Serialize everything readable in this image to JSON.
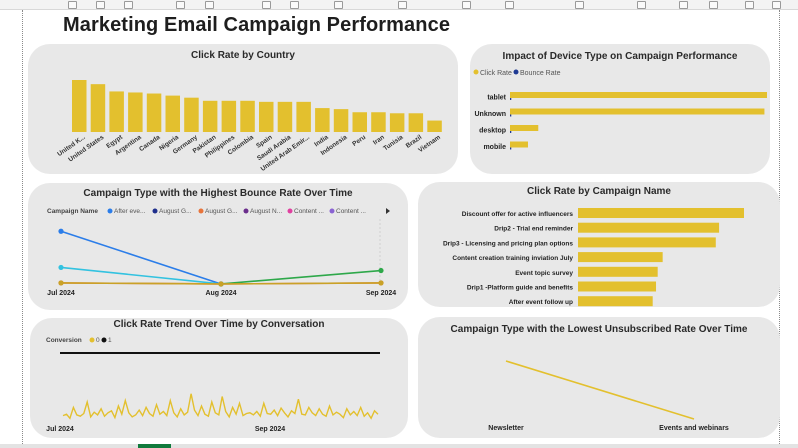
{
  "page": {
    "title": "Marketing Email Campaign Performance",
    "colors": {
      "gold": "#e3c02e",
      "card_bg": "#e8e8e8",
      "title": "#1e1e1e"
    }
  },
  "chart_data": [
    {
      "id": "click_rate_by_country",
      "type": "bar",
      "title": "Click Rate by Country",
      "categories": [
        "United K...",
        "United States",
        "Egypt",
        "Argentina",
        "Canada",
        "Nigeria",
        "Germany",
        "Pakistan",
        "Philippines",
        "Colombia",
        "Spain",
        "Saudi Arabia",
        "United Arab Emir...",
        "India",
        "Indonesia",
        "Peru",
        "Iran",
        "Tunisia",
        "Brazil",
        "Vietnam"
      ],
      "values": [
        50,
        46,
        39,
        38,
        37,
        35,
        33,
        30,
        30,
        30,
        29,
        29,
        29,
        23,
        22,
        19,
        19,
        18,
        18,
        11
      ],
      "color": "#e3c02e"
    },
    {
      "id": "device_type_impact",
      "type": "bar",
      "orientation": "horizontal",
      "title": "Impact of Device Type on Campaign Performance",
      "legend": [
        {
          "label": "Click Rate",
          "color": "#e3c02e"
        },
        {
          "label": "Bounce Rate",
          "color": "#1f3a93"
        }
      ],
      "categories": [
        "tablet",
        "Unknown",
        "desktop",
        "mobile"
      ],
      "series": [
        {
          "name": "Click Rate",
          "values": [
            100,
            99,
            11,
            7
          ]
        },
        {
          "name": "Bounce Rate",
          "values": [
            0.5,
            0.5,
            0.5,
            0.5
          ]
        }
      ]
    },
    {
      "id": "campaign_type_bounce_rate",
      "type": "line",
      "title": "Campaign Type with the Highest Bounce Rate Over Time",
      "legend_title": "Campaign Name",
      "x": [
        "Jul 2024",
        "Aug 2024",
        "Sep 2024"
      ],
      "series": [
        {
          "name": "After eve...",
          "color": "#2b7de9",
          "values": [
            52,
            1,
            null
          ]
        },
        {
          "name": "August G...",
          "color": "#1f2f8c",
          "values": [
            null,
            null,
            null
          ]
        },
        {
          "name": "August G...",
          "color": "#e8743b",
          "values": [
            2,
            1,
            2
          ]
        },
        {
          "name": "August N...",
          "color": "#6b2e8c",
          "values": [
            null,
            null,
            null
          ]
        },
        {
          "name": "Content ...",
          "color": "#e040a0",
          "values": [
            null,
            1,
            null
          ]
        },
        {
          "name": "Content ...",
          "color": "#8a63d2",
          "values": [
            null,
            null,
            null
          ]
        },
        {
          "name": "",
          "color": "#32c2e0",
          "values": [
            17,
            1,
            null
          ]
        },
        {
          "name": "",
          "color": "#2ea84a",
          "values": [
            null,
            1,
            14
          ]
        },
        {
          "name": "",
          "color": "#c9a227",
          "values": [
            2,
            1,
            2
          ]
        }
      ],
      "ylim": [
        0,
        60
      ]
    },
    {
      "id": "click_rate_by_campaign_name",
      "type": "bar",
      "orientation": "horizontal",
      "title": "Click Rate by Campaign Name",
      "categories": [
        "Discount offer for active influencers",
        "Drip2 - Trial end reminder",
        "Drip3 - Licensing and pricing plan options",
        "Content creation training inviation July",
        "Event topic survey",
        "Drip1 -Platform guide and benefits",
        "After event follow up"
      ],
      "values": [
        100,
        85,
        83,
        51,
        48,
        47,
        45
      ],
      "color": "#e3c02e"
    },
    {
      "id": "click_rate_trend_by_conversation",
      "type": "line",
      "title": "Click Rate Trend Over Time by Conversation",
      "legend_title": "Conversion",
      "legend": [
        {
          "label": "0",
          "color": "#e3c02e"
        },
        {
          "label": "1",
          "color": "#111111"
        }
      ],
      "x_ticks": [
        "Jul 2024",
        "Aug 2024",
        "Sep 2024"
      ],
      "series": [
        {
          "name": "0",
          "color": "#e3c02e",
          "values": [
            8,
            10,
            4,
            20,
            9,
            7,
            11,
            28,
            6,
            13,
            9,
            18,
            7,
            12,
            15,
            5,
            22,
            10,
            30,
            12,
            6,
            9,
            16,
            8,
            20,
            11,
            7,
            24,
            10,
            14,
            8,
            30,
            12,
            6,
            18,
            9,
            13,
            40,
            16,
            8,
            22,
            10,
            7,
            28,
            12,
            9,
            36,
            14,
            6,
            20,
            10,
            26,
            8,
            11,
            12,
            9,
            14,
            7,
            26,
            11,
            10,
            16,
            8,
            19,
            12,
            6,
            15,
            11,
            32,
            10,
            9,
            20,
            12,
            8,
            18,
            10,
            7,
            22,
            9,
            13,
            10,
            5,
            18,
            9,
            14,
            8,
            20,
            7,
            12,
            4,
            15,
            10
          ]
        },
        {
          "name": "1",
          "color": "#111111",
          "values": [
            100,
            100
          ]
        }
      ],
      "ylim": [
        0,
        100
      ]
    },
    {
      "id": "lowest_unsubscribed_rate",
      "type": "line",
      "title": "Campaign Type with the Lowest Unsubscribed Rate Over Time",
      "x": [
        "Newsletter",
        "Events and webinars"
      ],
      "values": [
        100,
        0
      ],
      "color": "#e3c02e"
    }
  ]
}
